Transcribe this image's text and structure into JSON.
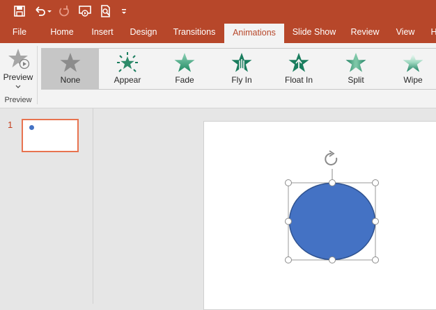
{
  "quick_access": {
    "icons": [
      "save-icon",
      "undo-icon",
      "redo-icon",
      "present-from-beginning-icon",
      "print-preview-icon",
      "customize-qat-icon"
    ]
  },
  "tabs": [
    {
      "label": "File",
      "active": false
    },
    {
      "label": "Home",
      "active": false
    },
    {
      "label": "Insert",
      "active": false
    },
    {
      "label": "Design",
      "active": false
    },
    {
      "label": "Transitions",
      "active": false
    },
    {
      "label": "Animations",
      "active": true
    },
    {
      "label": "Slide Show",
      "active": false
    },
    {
      "label": "Review",
      "active": false
    },
    {
      "label": "View",
      "active": false
    },
    {
      "label": "H",
      "active": false
    }
  ],
  "ribbon": {
    "preview_label": "Preview",
    "preview_group_label": "Preview",
    "animations": [
      {
        "label": "None",
        "selected": true
      },
      {
        "label": "Appear",
        "selected": false
      },
      {
        "label": "Fade",
        "selected": false
      },
      {
        "label": "Fly In",
        "selected": false
      },
      {
        "label": "Float In",
        "selected": false
      },
      {
        "label": "Split",
        "selected": false
      },
      {
        "label": "Wipe",
        "selected": false
      }
    ]
  },
  "slides_pane": {
    "slide_number": "1"
  },
  "colors": {
    "accent": "#b7472a",
    "shape_fill": "#4472c4",
    "shape_stroke": "#2f528f",
    "thumb_border": "#e8734f",
    "star_green": "#1a7d5e"
  }
}
